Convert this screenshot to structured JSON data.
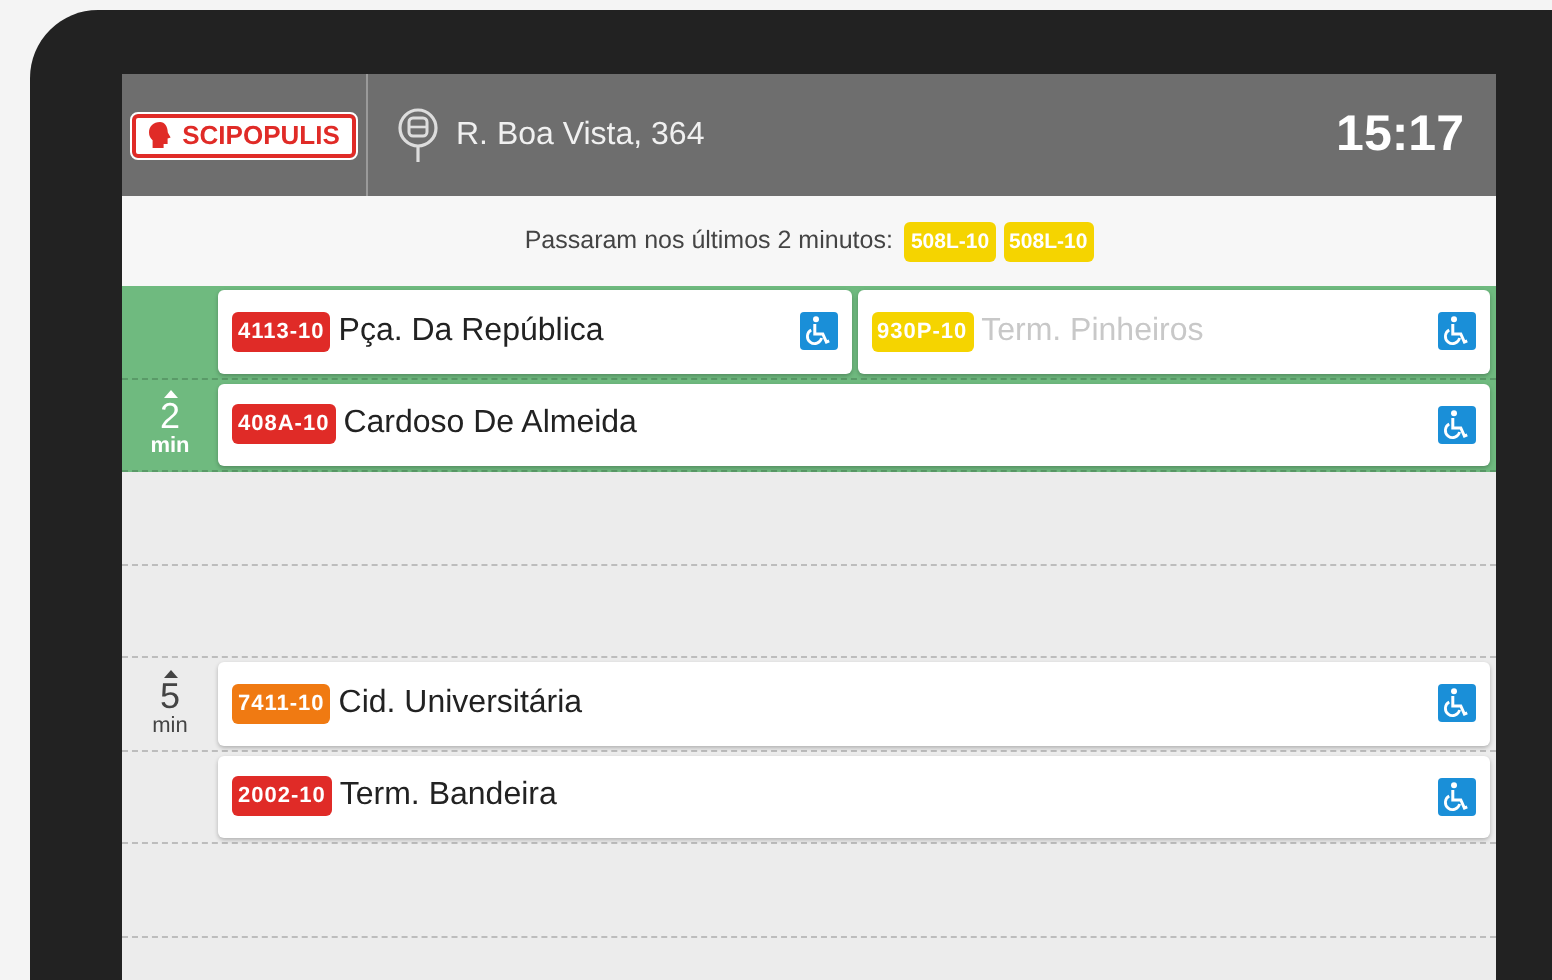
{
  "header": {
    "brand": "SCIPOPULIS",
    "stop": "R. Boa Vista, 364",
    "time": "15:17"
  },
  "recent": {
    "label": "Passaram nos últimos 2 minutos:",
    "buses": [
      {
        "line": "508L-10",
        "color": "#f5d400"
      },
      {
        "line": "508L-10",
        "color": "#f5d400"
      }
    ]
  },
  "rows": [
    {
      "highlighted": true,
      "buses": [
        {
          "line": "4113-10",
          "color": "#e02b27",
          "destination": "Pça. Da República",
          "dimmed": false,
          "accessible": true
        },
        {
          "line": "930P-10",
          "color": "#f5d400",
          "destination": "Term. Pinheiros",
          "dimmed": true,
          "accessible": true
        }
      ]
    },
    {
      "highlighted": true,
      "minutes": "2",
      "unit": "min",
      "buses": [
        {
          "line": "408A-10",
          "color": "#e02b27",
          "destination": "Cardoso De Almeida",
          "dimmed": false,
          "accessible": true
        }
      ]
    },
    {
      "highlighted": false,
      "buses": []
    },
    {
      "highlighted": false,
      "buses": []
    },
    {
      "highlighted": false,
      "minutes": "5",
      "unit": "min",
      "buses": [
        {
          "line": "7411-10",
          "color": "#f07a12",
          "destination": "Cid. Universitária",
          "dimmed": false,
          "accessible": true
        }
      ]
    },
    {
      "highlighted": false,
      "buses": [
        {
          "line": "2002-10",
          "color": "#e02b27",
          "destination": "Term. Bandeira",
          "dimmed": false,
          "accessible": true
        }
      ]
    },
    {
      "highlighted": false,
      "buses": []
    },
    {
      "highlighted": false,
      "buses": []
    }
  ]
}
